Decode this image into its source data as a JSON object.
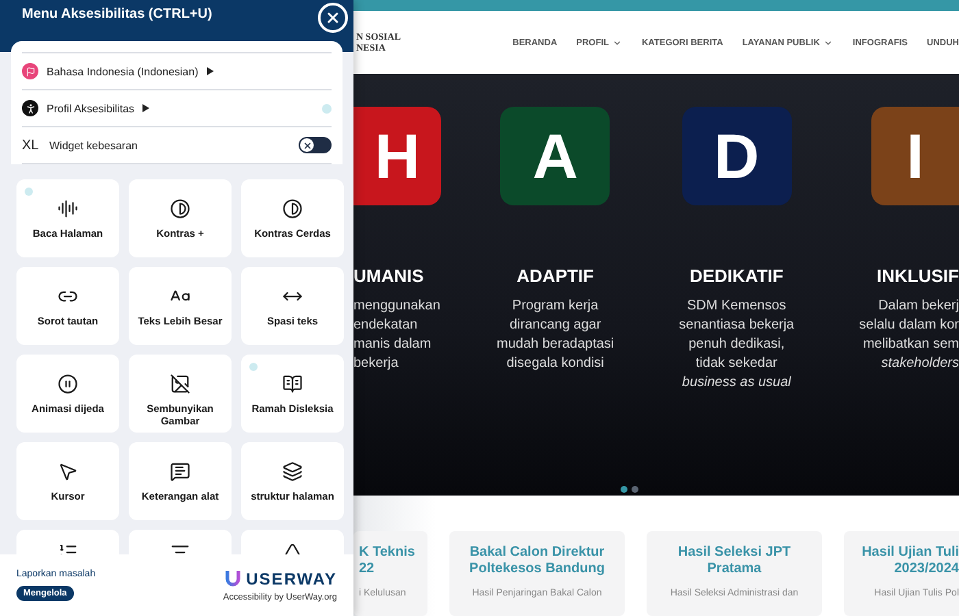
{
  "panel": {
    "title": "Menu Aksesibilitas (CTRL+U)",
    "rows": [
      {
        "kind": "language",
        "label": "Bahasa Indonesia (Indonesian)",
        "info": false
      },
      {
        "kind": "profile",
        "label": "Profil Aksesibilitas",
        "info": true
      },
      {
        "kind": "toggle",
        "prefix": "XL",
        "label": "Widget kebesaran",
        "on": false
      }
    ],
    "tiles": [
      {
        "kind": "full",
        "label": "Baca Halaman",
        "info": true
      },
      {
        "kind": "full",
        "label": "Kontras +",
        "info": false
      },
      {
        "kind": "full",
        "label": "Kontras Cerdas",
        "info": false
      },
      {
        "kind": "full",
        "label": "Sorot tautan",
        "info": false
      },
      {
        "kind": "full",
        "label": "Teks Lebih Besar",
        "info": false
      },
      {
        "kind": "full",
        "label": "Spasi teks",
        "info": false
      },
      {
        "kind": "full",
        "label": "Animasi dijeda",
        "info": false
      },
      {
        "kind": "full",
        "label": "Sembunyikan Gambar",
        "info": false
      },
      {
        "kind": "full",
        "label": "Ramah Disleksia",
        "info": true
      },
      {
        "kind": "full",
        "label": "Kursor",
        "info": false
      },
      {
        "kind": "full",
        "label": "Keterangan alat",
        "info": false
      },
      {
        "kind": "full",
        "label": "struktur halaman",
        "info": false
      },
      {
        "kind": "partial"
      },
      {
        "kind": "partial"
      },
      {
        "kind": "partial"
      }
    ],
    "footer": {
      "report_link": "Laporkan masalah",
      "manage_button": "Mengelola",
      "brand": "USERWAY",
      "credit": "Accessibility by UserWay.org"
    }
  },
  "site": {
    "logo_lines": [
      "N SOSIAL",
      "NESIA"
    ],
    "nav": [
      {
        "label": "BERANDA",
        "dropdown": false
      },
      {
        "label": "PROFIL",
        "dropdown": true
      },
      {
        "label": "KATEGORI BERITA",
        "dropdown": false
      },
      {
        "label": "LAYANAN PUBLIK",
        "dropdown": true
      },
      {
        "label": "INFOGRAFIS",
        "dropdown": false
      },
      {
        "label": "UNDUH",
        "dropdown": false
      }
    ],
    "values": [
      {
        "letter": "H",
        "color": "#c8161d",
        "title": "UMANIS",
        "lines": [
          "menggunakan",
          "endekatan",
          "manis dalam",
          "bekerja"
        ]
      },
      {
        "letter": "A",
        "color": "#0b4a2a",
        "title": "ADAPTIF",
        "lines": [
          "Program kerja",
          "dirancang agar",
          "mudah beradaptasi",
          "disegala kondisi"
        ]
      },
      {
        "letter": "D",
        "color": "#0c1f4f",
        "title": "DEDIKATIF",
        "lines": [
          "SDM Kemensos",
          "senantiasa bekerja",
          "penuh dedikasi,",
          "tidak sekedar",
          "*business as usual*"
        ]
      },
      {
        "letter": "I",
        "color": "#7b4219",
        "title": "INKLUSIF",
        "lines": [
          "Dalam bekerj",
          "selalu dalam kor",
          "melibatkan sem",
          "*stakeholders*"
        ]
      }
    ],
    "slides": [
      {
        "selected": true
      },
      {
        "selected": false
      }
    ],
    "news": [
      {
        "title": [
          "K Teknis",
          "22"
        ],
        "text": "i Kelulusan"
      },
      {
        "title": [
          "Bakal Calon Direktur",
          "Poltekesos Bandung"
        ],
        "text": "Hasil Penjaringan Bakal Calon"
      },
      {
        "title": [
          "Hasil Seleksi JPT",
          "Pratama"
        ],
        "text": "Hasil Seleksi Administrasi dan"
      },
      {
        "title": [
          "Hasil Ujian Tuli",
          "2023/2024"
        ],
        "text": "Hasil Ujian Tulis Pol"
      }
    ]
  }
}
